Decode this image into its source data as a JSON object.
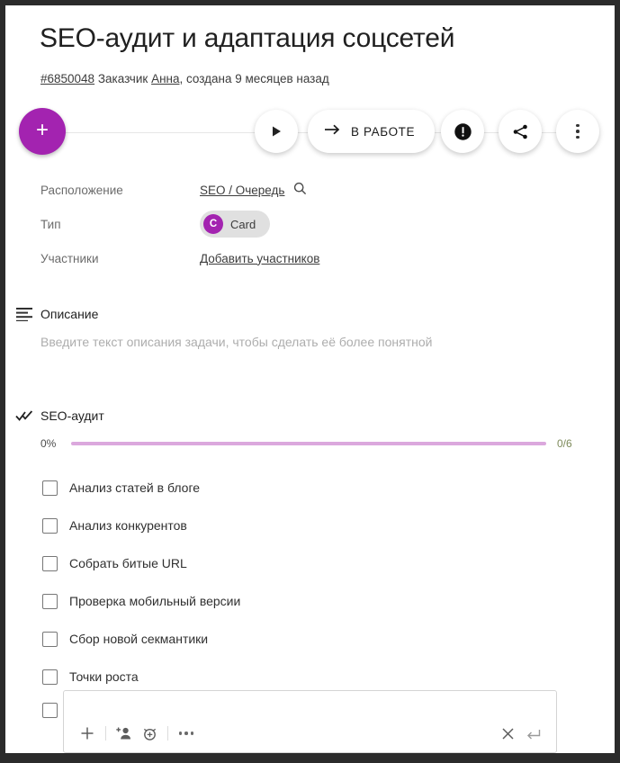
{
  "task": {
    "title": "SEO-аудит и адаптация соцсетей",
    "id_label": "#6850048",
    "customer_label": "Заказчик",
    "customer_name": "Анна",
    "created_text": ", создана 9 месяцев назад"
  },
  "actions": {
    "add_label": "+",
    "play_name": "play-icon",
    "status_label": "В РАБОТЕ",
    "status_arrow": "arrow-right-icon",
    "alert_name": "exclamation-icon",
    "share_name": "share-icon",
    "more_name": "more-vertical-icon"
  },
  "meta": {
    "rows": [
      {
        "label": "Расположение",
        "value": "SEO / Очередь",
        "type": "link",
        "icon": "search-icon"
      },
      {
        "label": "Тип",
        "value": "Card",
        "type": "chip",
        "avatar": "C"
      },
      {
        "label": "Участники",
        "value": "Добавить участников",
        "type": "link"
      }
    ]
  },
  "description": {
    "icon": "description-lines-icon",
    "title": "Описание",
    "placeholder": "Введите текст описания задачи, чтобы сделать её более понятной"
  },
  "checklist": {
    "icon": "double-check-icon",
    "title": "SEO-аудит",
    "progress_percent": "0%",
    "progress_value": 0,
    "progress_count": "0/6",
    "items": [
      {
        "label": "Анализ статей в блоге",
        "checked": false
      },
      {
        "label": "Анализ конкурентов",
        "checked": false
      },
      {
        "label": "Собрать битые URL",
        "checked": false
      },
      {
        "label": "Проверка мобильный версии",
        "checked": false
      },
      {
        "label": "Сбор новой секмантики",
        "checked": false
      },
      {
        "label": "Точки роста",
        "checked": false
      }
    ]
  },
  "editor": {
    "value": "",
    "placeholder": "",
    "tools": [
      {
        "name": "plus-icon"
      },
      {
        "name": "add-person-icon"
      },
      {
        "name": "alarm-clock-icon"
      },
      {
        "name": "more-horizontal-icon"
      }
    ],
    "close_name": "close-icon",
    "submit_name": "enter-return-icon"
  },
  "colors": {
    "accent": "#a323b0",
    "progress_track": "#dba8dd",
    "count_text": "#7d8a5a",
    "chip_bg": "#e0e0e0"
  }
}
